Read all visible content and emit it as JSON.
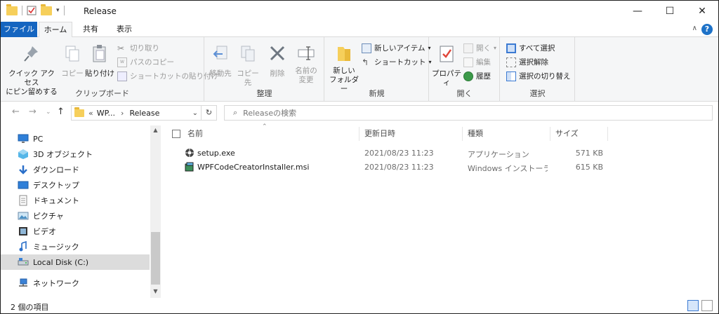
{
  "window": {
    "title": "Release",
    "minimize": "—",
    "maximize": "☐",
    "close": "✕"
  },
  "ribbon_tabs": {
    "file": "ファイル",
    "home": "ホーム",
    "share": "共有",
    "view": "表示"
  },
  "ribbon": {
    "clipboard": {
      "label": "クリップボード",
      "quick_access_line1": "クイック アクセス",
      "quick_access_line2": "にピン留めする",
      "copy": "コピー",
      "paste": "貼り付け",
      "cut": "切り取り",
      "copy_path": "パスのコピー",
      "paste_shortcut": "ショートカットの貼り付け"
    },
    "organize": {
      "label": "整理",
      "move_to": "移動先",
      "copy_to": "コピー先",
      "delete": "削除",
      "rename_line1": "名前の",
      "rename_line2": "変更"
    },
    "new": {
      "label": "新規",
      "new_folder_line1": "新しい",
      "new_folder_line2": "フォルダー",
      "new_item": "新しいアイテム",
      "shortcut": "ショートカット"
    },
    "open": {
      "label": "開く",
      "properties": "プロパティ",
      "open": "開く",
      "edit": "編集",
      "history": "履歴"
    },
    "select": {
      "label": "選択",
      "select_all": "すべて選択",
      "select_none": "選択解除",
      "invert": "選択の切り替え"
    }
  },
  "address": {
    "prefix": "«",
    "crumb1": "WP...",
    "sep": "›",
    "crumb2": "Release",
    "search_placeholder": "Releaseの検索"
  },
  "nav_pane": {
    "items": [
      {
        "label": "PC",
        "icon": "pc-icon"
      },
      {
        "label": "3D オブジェクト",
        "icon": "3d-objects-icon"
      },
      {
        "label": "ダウンロード",
        "icon": "download-icon"
      },
      {
        "label": "デスクトップ",
        "icon": "desktop-icon"
      },
      {
        "label": "ドキュメント",
        "icon": "documents-icon"
      },
      {
        "label": "ピクチャ",
        "icon": "pictures-icon"
      },
      {
        "label": "ビデオ",
        "icon": "videos-icon"
      },
      {
        "label": "ミュージック",
        "icon": "music-icon"
      },
      {
        "label": "Local Disk (C:)",
        "icon": "disk-icon"
      },
      {
        "label": "ネットワーク",
        "icon": "network-icon"
      }
    ]
  },
  "file_list": {
    "columns": {
      "name": "名前",
      "modified": "更新日時",
      "type": "種類",
      "size": "サイズ"
    },
    "rows": [
      {
        "name": "setup.exe",
        "modified": "2021/08/23 11:23",
        "type": "アプリケーション",
        "size": "571 KB"
      },
      {
        "name": "WPFCodeCreatorInstaller.msi",
        "modified": "2021/08/23 11:23",
        "type": "Windows インストーラー ...",
        "size": "615 KB"
      }
    ]
  },
  "status": {
    "item_count": "2 個の項目"
  }
}
